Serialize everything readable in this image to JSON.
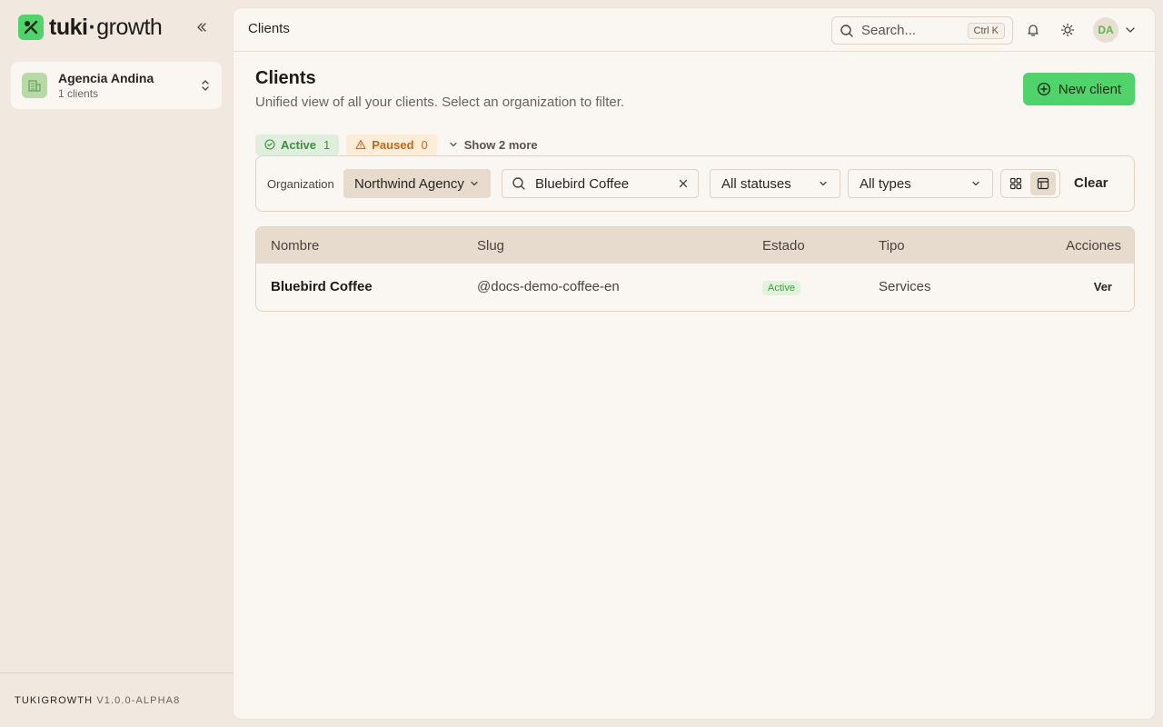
{
  "brand": {
    "name_bold": "tuki",
    "dot": "·",
    "name_rest": "growth"
  },
  "sidebar": {
    "org_name": "Agencia Andina",
    "org_count": "1 clients",
    "footer_name": "TUKIGROWTH",
    "footer_version": "V1.0.0-ALPHA8"
  },
  "topbar": {
    "title": "Clients",
    "search_placeholder": "Search...",
    "search_shortcut": "Ctrl K",
    "avatar_initials": "DA"
  },
  "page": {
    "title": "Clients",
    "subtitle": "Unified view of all your clients. Select an organization to filter.",
    "new_button": "New client"
  },
  "chips": {
    "active_label": "Active",
    "active_count": "1",
    "paused_label": "Paused",
    "paused_count": "0",
    "more_label": "Show 2 more"
  },
  "filters": {
    "org_label": "Organization",
    "org_value": "Northwind Agency",
    "search_value": "Bluebird Coffee",
    "status_value": "All statuses",
    "type_value": "All types",
    "clear_label": "Clear"
  },
  "table": {
    "headers": {
      "name": "Nombre",
      "slug": "Slug",
      "status": "Estado",
      "type": "Tipo",
      "actions": "Acciones"
    },
    "rows": [
      {
        "name": "Bluebird Coffee",
        "slug": "@docs-demo-coffee-en",
        "status": "Active",
        "type": "Services",
        "action": "Ver"
      }
    ]
  },
  "colors": {
    "accent": "#4fd36a",
    "background": "#f1e9df",
    "panel": "#faf6f2"
  }
}
